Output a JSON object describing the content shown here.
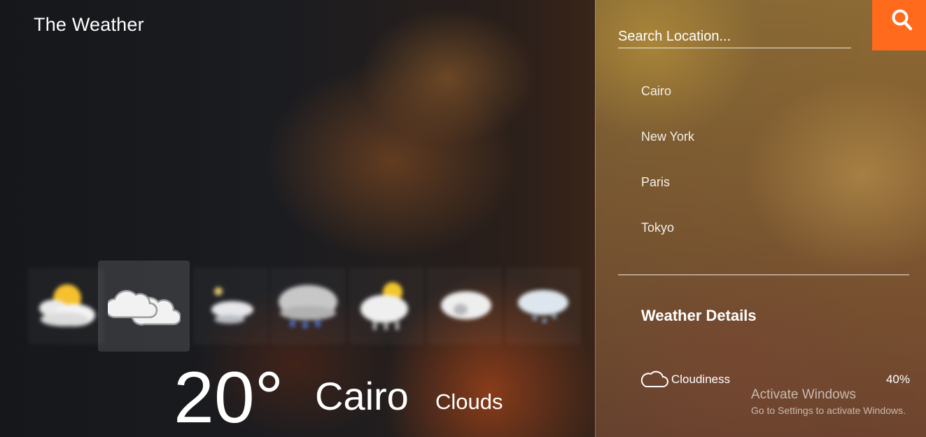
{
  "app": {
    "title": "The Weather"
  },
  "forecast": [
    {
      "icon": "partly-sunny-icon"
    },
    {
      "icon": "cloudy-icon",
      "selected": true
    },
    {
      "icon": "night-cloud-icon"
    },
    {
      "icon": "rain-cloud-icon"
    },
    {
      "icon": "sun-cloud-icon"
    },
    {
      "icon": "overcast-icon"
    },
    {
      "icon": "drizzle-icon"
    }
  ],
  "current": {
    "temperature": "20°",
    "city": "Cairo",
    "condition": "Clouds"
  },
  "search": {
    "placeholder": "Search Location...",
    "value": "",
    "button_icon": "search-icon",
    "button_color": "#ff6a1c"
  },
  "locations": [
    "Cairo",
    "New York",
    "Paris",
    "Tokyo"
  ],
  "details": {
    "title": "Weather Details",
    "items": [
      {
        "icon": "cloud-icon",
        "label": "Cloudiness",
        "value": "40%"
      }
    ]
  },
  "watermark": {
    "title": "Activate Windows",
    "subtitle": "Go to Settings to activate Windows."
  }
}
